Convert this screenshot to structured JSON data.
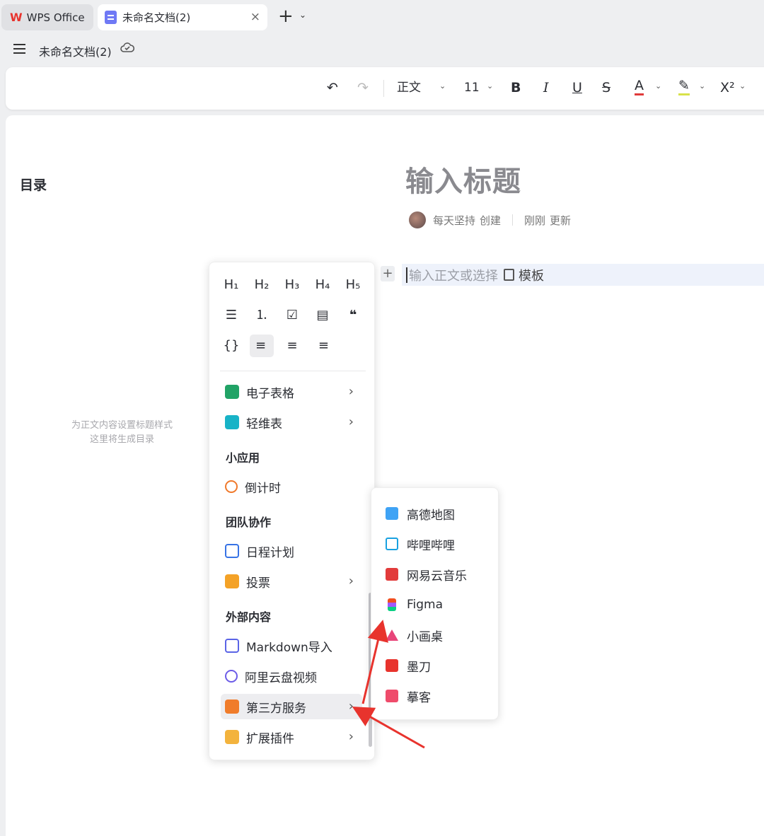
{
  "tabs": {
    "app_label": "WPS Office",
    "doc_label": "未命名文档(2)",
    "close_glyph": "×",
    "new_tab_glyph": "+",
    "chevron_glyph": "⌄"
  },
  "docbar": {
    "title": "未命名文档(2)"
  },
  "toolbar": {
    "undo": "↶",
    "redo": "↷",
    "style": "正文",
    "font_size": "11",
    "bold": "B",
    "italic": "I",
    "underline": "U",
    "strike": "S",
    "font_color": "A",
    "highlight": "✎",
    "superscript": "X²",
    "chevron": "⌄"
  },
  "toc": {
    "title": "目录",
    "hint_line1": "为正文内容设置标题样式",
    "hint_line2": "这里将生成目录"
  },
  "document": {
    "heading_placeholder": "输入标题",
    "author": "每天坚持",
    "created_label": "创建",
    "updated_time": "刚刚",
    "updated_label": "更新",
    "body_placeholder": "输入正文或选择",
    "template_label": "模板",
    "plus": "+"
  },
  "insert_menu": {
    "headings": [
      "H₁",
      "H₂",
      "H₃",
      "H₄",
      "H₅"
    ],
    "blocks": [
      "☰",
      "⒈",
      "☑",
      "▤",
      "❝"
    ],
    "aligns": [
      "{}",
      "≡",
      "≡",
      "≡"
    ],
    "items": {
      "spreadsheet": "电子表格",
      "light_table": "轻维表",
      "section_apps": "小应用",
      "countdown": "倒计时",
      "section_team": "团队协作",
      "schedule": "日程计划",
      "vote": "投票",
      "section_external": "外部内容",
      "markdown_import": "Markdown导入",
      "aliyun_video": "阿里云盘视频",
      "third_party": "第三方服务",
      "extensions": "扩展插件"
    },
    "arrow": "›"
  },
  "third_party_submenu": [
    {
      "label": "高德地图",
      "icon": "amap-icon",
      "color": "#3fa3f5"
    },
    {
      "label": "哔哩哔哩",
      "icon": "bilibili-icon",
      "color": "#19a1e0"
    },
    {
      "label": "网易云音乐",
      "icon": "netease-music-icon",
      "color": "#e23b3b"
    },
    {
      "label": "Figma",
      "icon": "figma-icon",
      "color": "#f24e1e"
    },
    {
      "label": "小画桌",
      "icon": "xiaohuazhuo-icon",
      "color": "#e8457a"
    },
    {
      "label": "墨刀",
      "icon": "modao-icon",
      "color": "#e8332d"
    },
    {
      "label": "摹客",
      "icon": "mockplus-icon",
      "color": "#ef4b6b"
    }
  ],
  "colors": {
    "accent_red": "#e8332d",
    "annotation_arrow": "#e8332d",
    "highlight_bg": "#eef2fb"
  }
}
